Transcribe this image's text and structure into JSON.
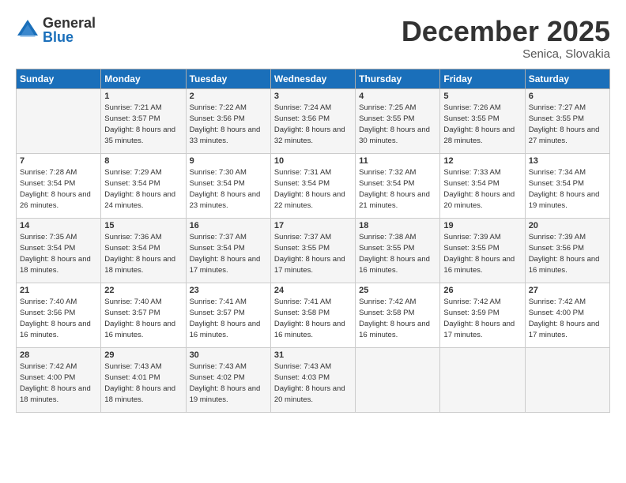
{
  "logo": {
    "general": "General",
    "blue": "Blue"
  },
  "header": {
    "month": "December 2025",
    "location": "Senica, Slovakia"
  },
  "weekdays": [
    "Sunday",
    "Monday",
    "Tuesday",
    "Wednesday",
    "Thursday",
    "Friday",
    "Saturday"
  ],
  "weeks": [
    [
      {
        "day": "",
        "sunrise": "",
        "sunset": "",
        "daylight": ""
      },
      {
        "day": "1",
        "sunrise": "Sunrise: 7:21 AM",
        "sunset": "Sunset: 3:57 PM",
        "daylight": "Daylight: 8 hours and 35 minutes."
      },
      {
        "day": "2",
        "sunrise": "Sunrise: 7:22 AM",
        "sunset": "Sunset: 3:56 PM",
        "daylight": "Daylight: 8 hours and 33 minutes."
      },
      {
        "day": "3",
        "sunrise": "Sunrise: 7:24 AM",
        "sunset": "Sunset: 3:56 PM",
        "daylight": "Daylight: 8 hours and 32 minutes."
      },
      {
        "day": "4",
        "sunrise": "Sunrise: 7:25 AM",
        "sunset": "Sunset: 3:55 PM",
        "daylight": "Daylight: 8 hours and 30 minutes."
      },
      {
        "day": "5",
        "sunrise": "Sunrise: 7:26 AM",
        "sunset": "Sunset: 3:55 PM",
        "daylight": "Daylight: 8 hours and 28 minutes."
      },
      {
        "day": "6",
        "sunrise": "Sunrise: 7:27 AM",
        "sunset": "Sunset: 3:55 PM",
        "daylight": "Daylight: 8 hours and 27 minutes."
      }
    ],
    [
      {
        "day": "7",
        "sunrise": "Sunrise: 7:28 AM",
        "sunset": "Sunset: 3:54 PM",
        "daylight": "Daylight: 8 hours and 26 minutes."
      },
      {
        "day": "8",
        "sunrise": "Sunrise: 7:29 AM",
        "sunset": "Sunset: 3:54 PM",
        "daylight": "Daylight: 8 hours and 24 minutes."
      },
      {
        "day": "9",
        "sunrise": "Sunrise: 7:30 AM",
        "sunset": "Sunset: 3:54 PM",
        "daylight": "Daylight: 8 hours and 23 minutes."
      },
      {
        "day": "10",
        "sunrise": "Sunrise: 7:31 AM",
        "sunset": "Sunset: 3:54 PM",
        "daylight": "Daylight: 8 hours and 22 minutes."
      },
      {
        "day": "11",
        "sunrise": "Sunrise: 7:32 AM",
        "sunset": "Sunset: 3:54 PM",
        "daylight": "Daylight: 8 hours and 21 minutes."
      },
      {
        "day": "12",
        "sunrise": "Sunrise: 7:33 AM",
        "sunset": "Sunset: 3:54 PM",
        "daylight": "Daylight: 8 hours and 20 minutes."
      },
      {
        "day": "13",
        "sunrise": "Sunrise: 7:34 AM",
        "sunset": "Sunset: 3:54 PM",
        "daylight": "Daylight: 8 hours and 19 minutes."
      }
    ],
    [
      {
        "day": "14",
        "sunrise": "Sunrise: 7:35 AM",
        "sunset": "Sunset: 3:54 PM",
        "daylight": "Daylight: 8 hours and 18 minutes."
      },
      {
        "day": "15",
        "sunrise": "Sunrise: 7:36 AM",
        "sunset": "Sunset: 3:54 PM",
        "daylight": "Daylight: 8 hours and 18 minutes."
      },
      {
        "day": "16",
        "sunrise": "Sunrise: 7:37 AM",
        "sunset": "Sunset: 3:54 PM",
        "daylight": "Daylight: 8 hours and 17 minutes."
      },
      {
        "day": "17",
        "sunrise": "Sunrise: 7:37 AM",
        "sunset": "Sunset: 3:55 PM",
        "daylight": "Daylight: 8 hours and 17 minutes."
      },
      {
        "day": "18",
        "sunrise": "Sunrise: 7:38 AM",
        "sunset": "Sunset: 3:55 PM",
        "daylight": "Daylight: 8 hours and 16 minutes."
      },
      {
        "day": "19",
        "sunrise": "Sunrise: 7:39 AM",
        "sunset": "Sunset: 3:55 PM",
        "daylight": "Daylight: 8 hours and 16 minutes."
      },
      {
        "day": "20",
        "sunrise": "Sunrise: 7:39 AM",
        "sunset": "Sunset: 3:56 PM",
        "daylight": "Daylight: 8 hours and 16 minutes."
      }
    ],
    [
      {
        "day": "21",
        "sunrise": "Sunrise: 7:40 AM",
        "sunset": "Sunset: 3:56 PM",
        "daylight": "Daylight: 8 hours and 16 minutes."
      },
      {
        "day": "22",
        "sunrise": "Sunrise: 7:40 AM",
        "sunset": "Sunset: 3:57 PM",
        "daylight": "Daylight: 8 hours and 16 minutes."
      },
      {
        "day": "23",
        "sunrise": "Sunrise: 7:41 AM",
        "sunset": "Sunset: 3:57 PM",
        "daylight": "Daylight: 8 hours and 16 minutes."
      },
      {
        "day": "24",
        "sunrise": "Sunrise: 7:41 AM",
        "sunset": "Sunset: 3:58 PM",
        "daylight": "Daylight: 8 hours and 16 minutes."
      },
      {
        "day": "25",
        "sunrise": "Sunrise: 7:42 AM",
        "sunset": "Sunset: 3:58 PM",
        "daylight": "Daylight: 8 hours and 16 minutes."
      },
      {
        "day": "26",
        "sunrise": "Sunrise: 7:42 AM",
        "sunset": "Sunset: 3:59 PM",
        "daylight": "Daylight: 8 hours and 17 minutes."
      },
      {
        "day": "27",
        "sunrise": "Sunrise: 7:42 AM",
        "sunset": "Sunset: 4:00 PM",
        "daylight": "Daylight: 8 hours and 17 minutes."
      }
    ],
    [
      {
        "day": "28",
        "sunrise": "Sunrise: 7:42 AM",
        "sunset": "Sunset: 4:00 PM",
        "daylight": "Daylight: 8 hours and 18 minutes."
      },
      {
        "day": "29",
        "sunrise": "Sunrise: 7:43 AM",
        "sunset": "Sunset: 4:01 PM",
        "daylight": "Daylight: 8 hours and 18 minutes."
      },
      {
        "day": "30",
        "sunrise": "Sunrise: 7:43 AM",
        "sunset": "Sunset: 4:02 PM",
        "daylight": "Daylight: 8 hours and 19 minutes."
      },
      {
        "day": "31",
        "sunrise": "Sunrise: 7:43 AM",
        "sunset": "Sunset: 4:03 PM",
        "daylight": "Daylight: 8 hours and 20 minutes."
      },
      {
        "day": "",
        "sunrise": "",
        "sunset": "",
        "daylight": ""
      },
      {
        "day": "",
        "sunrise": "",
        "sunset": "",
        "daylight": ""
      },
      {
        "day": "",
        "sunrise": "",
        "sunset": "",
        "daylight": ""
      }
    ]
  ]
}
